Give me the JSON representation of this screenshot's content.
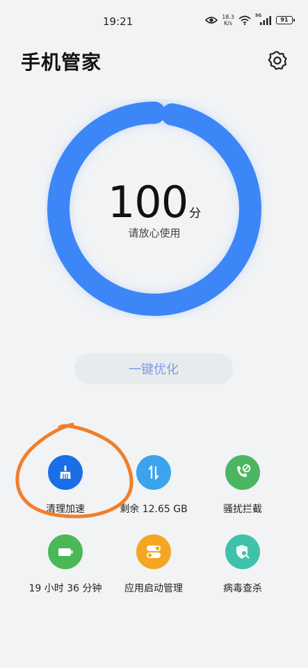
{
  "status_bar": {
    "time": "19:21",
    "net_speed_value": "18.3",
    "net_speed_unit": "K/s",
    "signal_type": "5G",
    "battery_level": "91"
  },
  "header": {
    "title": "手机管家"
  },
  "score": {
    "value": "100",
    "unit": "分",
    "subtitle": "请放心使用",
    "ring_fraction": 0.97
  },
  "actions": {
    "optimize_label": "一键优化"
  },
  "features": [
    {
      "label": "清理加速",
      "icon": "broom-icon",
      "color": "#1a6ee6"
    },
    {
      "label": "剩余 12.65 GB",
      "icon": "storage-icon",
      "color": "#3ba4ec"
    },
    {
      "label": "骚扰拦截",
      "icon": "block-call-icon",
      "color": "#4cb561"
    },
    {
      "label": "19 小时 36 分钟",
      "icon": "battery-icon",
      "color": "#4ab857"
    },
    {
      "label": "应用启动管理",
      "icon": "toggle-icon",
      "color": "#f5a623"
    },
    {
      "label": "病毒查杀",
      "icon": "shield-search-icon",
      "color": "#3fc2a9"
    }
  ],
  "colors": {
    "ring": "#3d86f7",
    "annotation": "#f07f2c"
  }
}
